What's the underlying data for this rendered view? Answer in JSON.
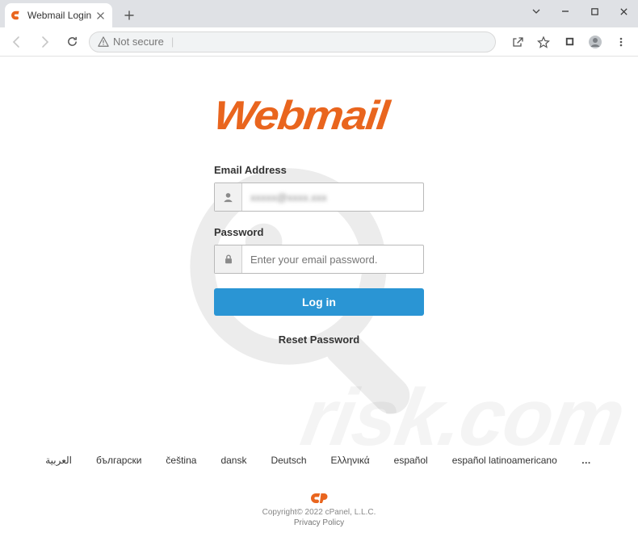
{
  "browser": {
    "tab_title": "Webmail Login",
    "security_text": "Not secure"
  },
  "logo": "Webmail",
  "form": {
    "email_label": "Email Address",
    "email_value": "xxxxx@xxxx.xxx",
    "password_label": "Password",
    "password_placeholder": "Enter your email password.",
    "login_button": "Log in",
    "reset_link": "Reset Password"
  },
  "locales": {
    "items": [
      "العربية",
      "български",
      "čeština",
      "dansk",
      "Deutsch",
      "Ελληνικά",
      "español",
      "español latinoamericano"
    ],
    "more": "…"
  },
  "footer": {
    "copyright": "Copyright© 2022 cPanel, L.L.C.",
    "privacy": "Privacy Policy"
  },
  "colors": {
    "brand_orange": "#e9651e",
    "login_blue": "#2a95d4"
  }
}
